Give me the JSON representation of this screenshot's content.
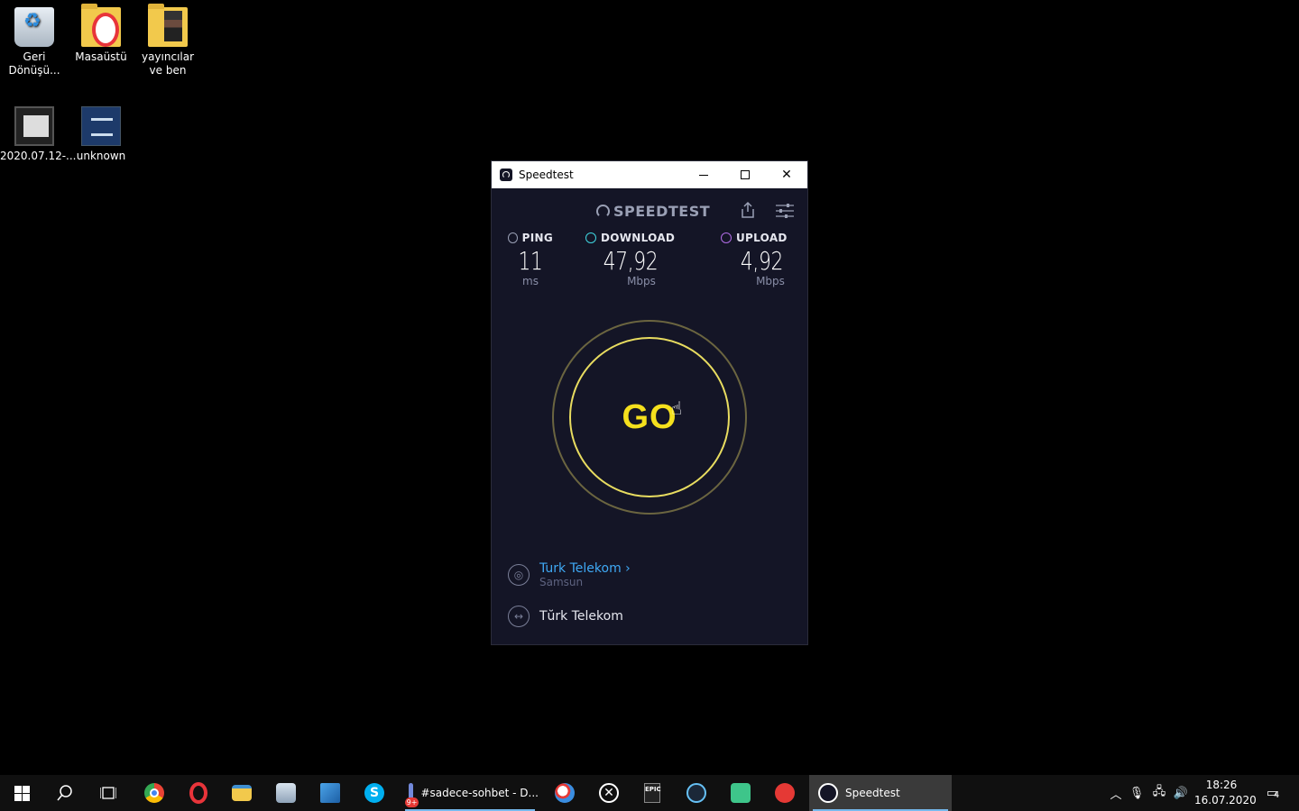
{
  "desktop": {
    "icons": [
      {
        "label": "Geri Dönüşü..."
      },
      {
        "label": "Masaüstü"
      },
      {
        "label": "yayıncılar ve ben"
      },
      {
        "label": "2020.07.12-..."
      },
      {
        "label": "unknown"
      }
    ]
  },
  "window": {
    "title": "Speedtest",
    "brand": "SPEEDTEST",
    "metrics": {
      "ping": {
        "label": "PING",
        "value": "11",
        "unit": "ms",
        "color": "#9aa0b5"
      },
      "download": {
        "label": "DOWNLOAD",
        "value": "47,92",
        "unit": "Mbps",
        "color": "#3fd5e0"
      },
      "upload": {
        "label": "UPLOAD",
        "value": "4,92",
        "unit": "Mbps",
        "color": "#b06ce6"
      }
    },
    "go_label": "GO",
    "server": {
      "name": "Turk Telekom",
      "location": "Samsun"
    },
    "provider": "Tŭrk Telekom",
    "accent_color": "#f5e01d"
  },
  "taskbar": {
    "discord_label": "#sadece-sohbet - D...",
    "discord_badge": "9+",
    "speedtest_label": "Speedtest",
    "clock_time": "18:26",
    "clock_date": "16.07.2020",
    "notification_count": "4"
  }
}
